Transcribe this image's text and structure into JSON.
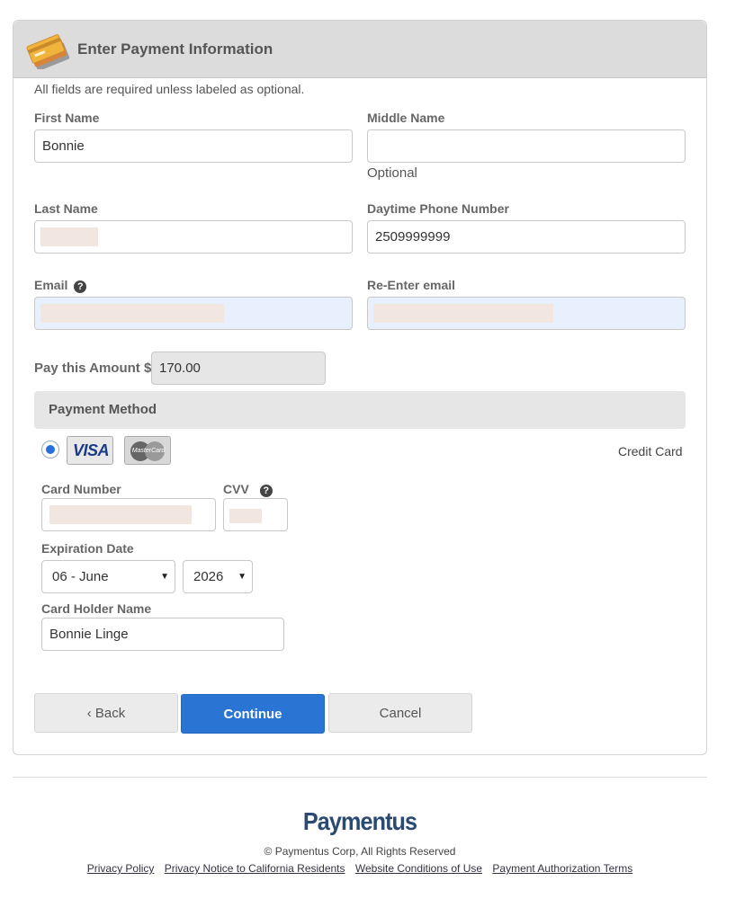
{
  "header": {
    "title": "Enter Payment Information"
  },
  "form": {
    "required_note": "All fields are required unless labeled as optional.",
    "first_name": {
      "label": "First Name",
      "value": "Bonnie"
    },
    "middle_name": {
      "label": "Middle Name",
      "value": "",
      "hint": "Optional"
    },
    "last_name": {
      "label": "Last Name",
      "value": ""
    },
    "phone": {
      "label": "Daytime Phone Number",
      "value": "2509999999"
    },
    "email": {
      "label": "Email",
      "value": ""
    },
    "reenter_email": {
      "label": "Re-Enter email",
      "value": ""
    },
    "amount": {
      "label": "Pay this Amount $",
      "value": "170.00"
    }
  },
  "payment": {
    "section_title": "Payment Method",
    "card_type_label": "Credit Card",
    "visa_label": "VISA",
    "mastercard_label": "MasterCard",
    "card_number": {
      "label": "Card Number",
      "value": ""
    },
    "cvv": {
      "label": "CVV",
      "value": ""
    },
    "expiration": {
      "label": "Expiration Date",
      "month": "06 - June",
      "year": "2026"
    },
    "card_holder": {
      "label": "Card Holder Name",
      "value": "Bonnie Linge"
    }
  },
  "buttons": {
    "back": "‹  Back",
    "continue": "Continue",
    "cancel": "Cancel"
  },
  "footer": {
    "brand": "Paymentus",
    "copyright": "© Paymentus Corp, All Rights Reserved",
    "links": [
      "Privacy Policy",
      "Privacy Notice to California Residents",
      "Website Conditions of Use",
      "Payment Authorization Terms"
    ]
  },
  "colors": {
    "accent": "#2a74d4",
    "brand": "#2a4a72",
    "header_bg": "#dcdcdc"
  },
  "icons": {
    "header": "credit-cards-icon",
    "help": "question-circle-icon"
  }
}
